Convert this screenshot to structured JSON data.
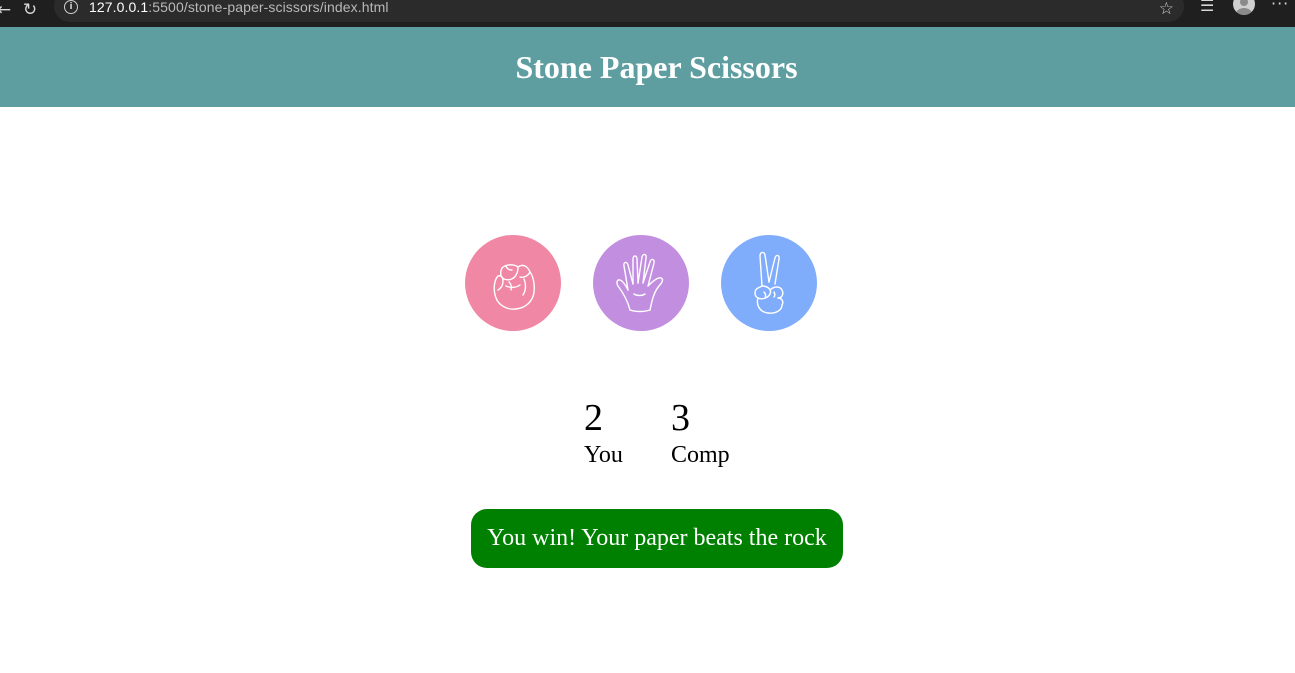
{
  "browser": {
    "url_host": "127.0.0.1",
    "url_rest": ":5500/stone-paper-scissors/index.html"
  },
  "header": {
    "title": "Stone Paper Scissors",
    "background": "#5f9ea0"
  },
  "choices": [
    {
      "id": "rock",
      "icon": "fist-icon",
      "color": "#f087a4"
    },
    {
      "id": "paper",
      "icon": "open-hand-icon",
      "color": "#c28edf"
    },
    {
      "id": "scissors",
      "icon": "peace-hand-icon",
      "color": "#80acfc"
    }
  ],
  "scores": {
    "user": {
      "value": "2",
      "label": "You"
    },
    "comp": {
      "value": "3",
      "label": "Comp"
    }
  },
  "message": {
    "text": "You win! Your paper beats the rock",
    "background": "#008000"
  }
}
